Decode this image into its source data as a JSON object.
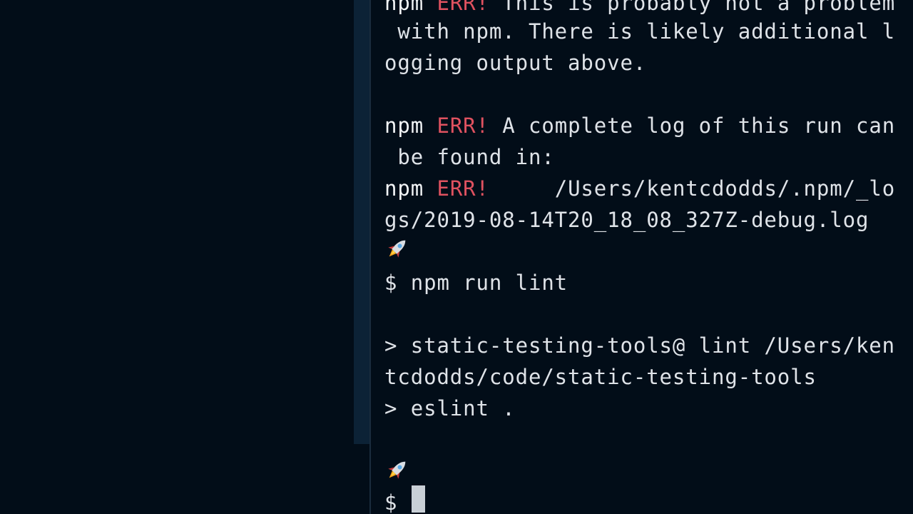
{
  "terminal": {
    "line1": {
      "prefix": "npm ",
      "err": "ERR!",
      "text": " This is probably not a problem"
    },
    "line2": {
      "text": " with npm. There is likely additional l"
    },
    "line3": {
      "text": "ogging output above."
    },
    "line4": {
      "prefix": "npm ",
      "err": "ERR!",
      "text": " A complete log of this run can"
    },
    "line5": {
      "text": " be found in:"
    },
    "line6": {
      "prefix": "npm ",
      "err": "ERR!",
      "text": "     /Users/kentcdodds/.npm/_lo"
    },
    "line7": {
      "text": "gs/2019-08-14T20_18_08_327Z-debug.log"
    },
    "line8": {
      "text": "$ npm run lint"
    },
    "line9": {
      "text": "> static-testing-tools@ lint /Users/ken"
    },
    "line10": {
      "text": "tcdodds/code/static-testing-tools"
    },
    "line11": {
      "text": "> eslint ."
    },
    "line12": {
      "text": "$ "
    }
  },
  "icons": {
    "prompt_icon": "rocket-icon"
  },
  "colors": {
    "background": "#020d18",
    "text": "#dfe3e8",
    "error": "#e05260",
    "scrollbar_thumb": "#0c2236",
    "cursor": "#c9cfd6"
  }
}
